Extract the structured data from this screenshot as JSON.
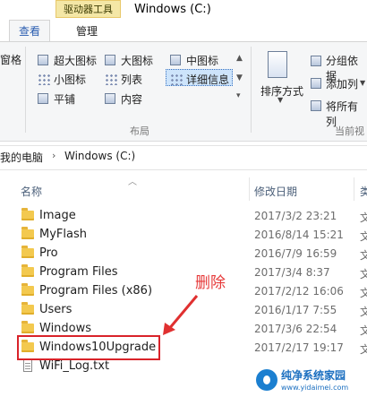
{
  "window": {
    "context_tab": "驱动器工具",
    "title": "Windows (C:)"
  },
  "ribbon": {
    "tabs": [
      "查看",
      "管理"
    ],
    "left_cut_label": "窗格",
    "layout": {
      "items": [
        "超大图标",
        "大图标",
        "中图标",
        "小图标",
        "列表",
        "详细信息",
        "平铺",
        "内容"
      ],
      "selected": "详细信息",
      "group_label": "布局"
    },
    "current_view": {
      "sort_label": "排序方式",
      "group_by": "分组依据",
      "add_column": "添加列",
      "fit_columns": "将所有列",
      "group_label": "当前视"
    }
  },
  "address": {
    "root": "我的电脑",
    "current": "Windows (C:)"
  },
  "list": {
    "columns": [
      "名称",
      "修改日期",
      "类"
    ],
    "rows": [
      {
        "name": "Image",
        "date": "2017/3/2 23:21",
        "type": "文",
        "kind": "folder"
      },
      {
        "name": "MyFlash",
        "date": "2016/8/14 15:21",
        "type": "文",
        "kind": "folder"
      },
      {
        "name": "Pro",
        "date": "2016/7/9 16:59",
        "type": "文",
        "kind": "folder"
      },
      {
        "name": "Program Files",
        "date": "2017/3/4 8:37",
        "type": "文",
        "kind": "folder"
      },
      {
        "name": "Program Files (x86)",
        "date": "2017/2/12 16:06",
        "type": "文",
        "kind": "folder"
      },
      {
        "name": "Users",
        "date": "2016/1/17 7:55",
        "type": "文",
        "kind": "folder"
      },
      {
        "name": "Windows",
        "date": "2017/3/6 22:54",
        "type": "文",
        "kind": "folder"
      },
      {
        "name": "Windows10Upgrade",
        "date": "2017/2/17 19:17",
        "type": "文",
        "kind": "folder"
      },
      {
        "name": "WiFi_Log.txt",
        "date": "",
        "type": "",
        "kind": "txt"
      }
    ]
  },
  "annotation": {
    "label": "删除",
    "color": "#e63a3a"
  },
  "watermark": {
    "line1": "纯净系统家园",
    "line2": "www.yidaimei.com"
  }
}
